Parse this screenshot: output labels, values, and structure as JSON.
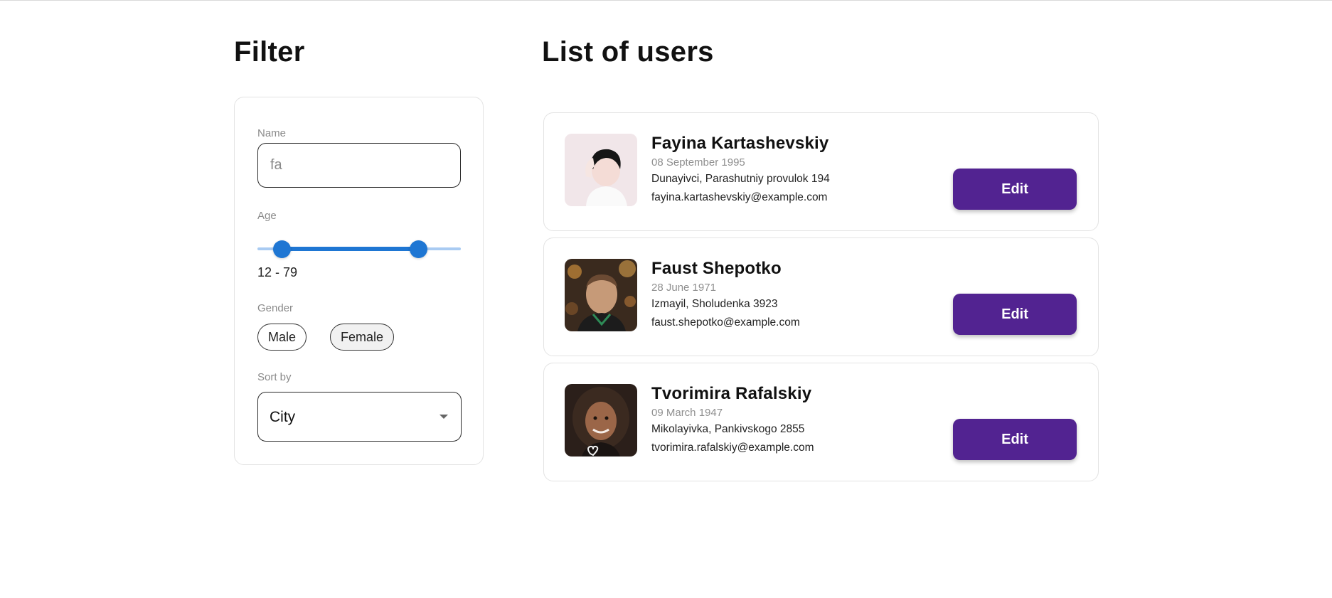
{
  "filter": {
    "title": "Filter",
    "name": {
      "label": "Name",
      "value": "fa",
      "placeholder": ""
    },
    "age": {
      "label": "Age",
      "min": 12,
      "max": 79,
      "range_min": 0,
      "range_max": 100,
      "range_text": "12 - 79"
    },
    "gender": {
      "label": "Gender",
      "options": [
        {
          "label": "Male",
          "selected": false
        },
        {
          "label": "Female",
          "selected": true
        }
      ]
    },
    "sort_by": {
      "label": "Sort by",
      "value": "City"
    }
  },
  "list": {
    "title": "List of users",
    "edit_label": "Edit",
    "users": [
      {
        "name": "Fayina Kartashevskiy",
        "birth": "08 September 1995",
        "address": "Dunayivci, Parashutniy provulok 194",
        "email": "fayina.kartashevskiy@example.com"
      },
      {
        "name": "Faust Shepotko",
        "birth": "28 June 1971",
        "address": "Izmayil, Sholudenka 3923",
        "email": "faust.shepotko@example.com"
      },
      {
        "name": "Tvorimira Rafalskiy",
        "birth": "09 March 1947",
        "address": "Mikolayivka, Pankivskogo 2855",
        "email": "tvorimira.rafalskiy@example.com"
      }
    ]
  },
  "colors": {
    "accent": "#522391",
    "slider": "#1e76d3",
    "slider_rail": "#a9cbf2"
  }
}
